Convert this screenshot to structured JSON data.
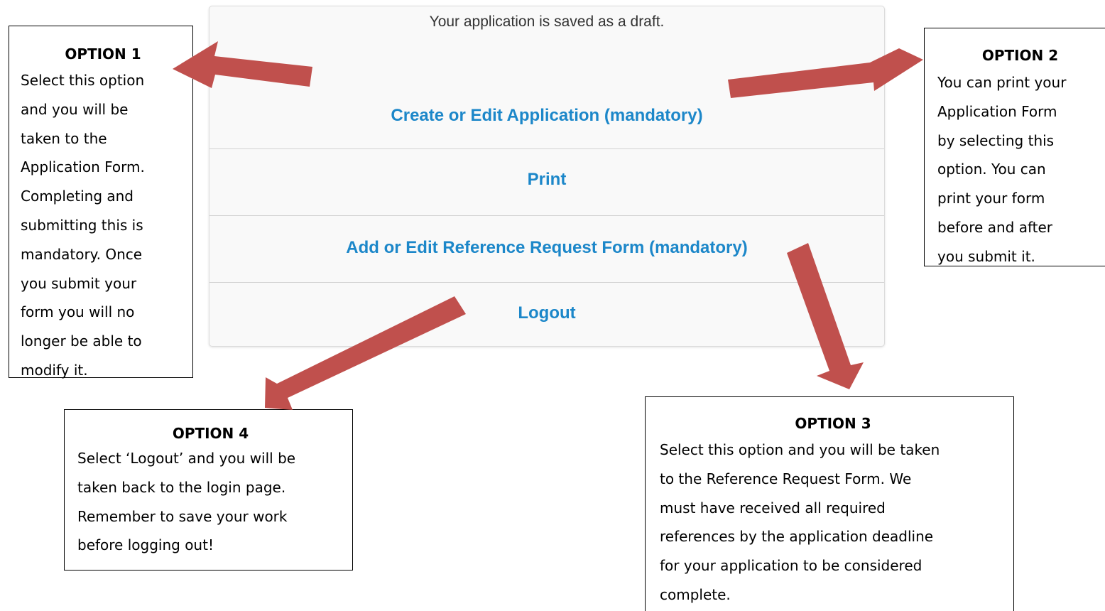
{
  "panel": {
    "status_message": "Your application is saved as a draft.",
    "link_color": "#1c87c9",
    "items": [
      {
        "label": "Create or Edit Application (mandatory)"
      },
      {
        "label": "Print"
      },
      {
        "label": "Add or Edit Reference Request Form (mandatory)"
      },
      {
        "label": "Logout"
      }
    ]
  },
  "callouts": {
    "option1": {
      "title": "OPTION 1",
      "lines": [
        "Select this option",
        "and you will be",
        "taken to the",
        "Application Form.",
        "Completing and",
        "submitting this is",
        "mandatory. Once",
        "you submit your",
        "form you will no",
        "longer be able to",
        "modify it."
      ]
    },
    "option2": {
      "title": "OPTION 2",
      "lines": [
        "You can print your",
        "Application Form",
        "by selecting this",
        "option. You can",
        "print your form",
        "before and after",
        "you submit it."
      ]
    },
    "option3": {
      "title": "OPTION 3",
      "lines": [
        "Select this option and you will be taken",
        "to the Reference Request Form. We",
        "must have received all required",
        "references by the application deadline",
        "for your application to be considered",
        "complete."
      ]
    },
    "option4": {
      "title": "OPTION 4",
      "lines": [
        "Select ‘Logout’ and you will be",
        "taken back to the login page.",
        "Remember to save your work",
        "before logging out!"
      ]
    }
  },
  "arrow_color": "#c0504d"
}
